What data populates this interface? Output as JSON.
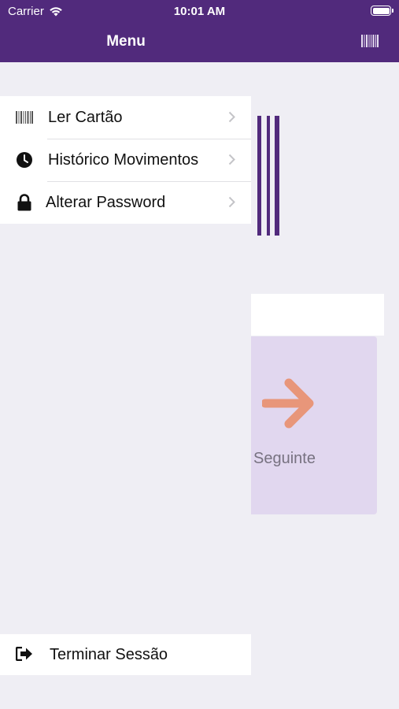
{
  "status_bar": {
    "carrier": "Carrier",
    "time": "10:01 AM"
  },
  "nav": {
    "title": "Menu",
    "right_icon": "barcode-icon"
  },
  "menu": {
    "items": [
      {
        "label": "Ler Cartão",
        "icon": "barcode-icon"
      },
      {
        "label": "Histórico Movimentos",
        "icon": "clock-icon"
      },
      {
        "label": "Alterar Password",
        "icon": "lock-icon"
      }
    ]
  },
  "main": {
    "next_label": "Seguinte",
    "next_icon": "arrow-right-icon"
  },
  "logout": {
    "label": "Terminar Sessão",
    "icon": "sign-out-icon"
  },
  "colors": {
    "brand": "#512a7c",
    "background": "#efeef4",
    "next_card": "#e1d7ef",
    "arrow": "#e8967a"
  }
}
